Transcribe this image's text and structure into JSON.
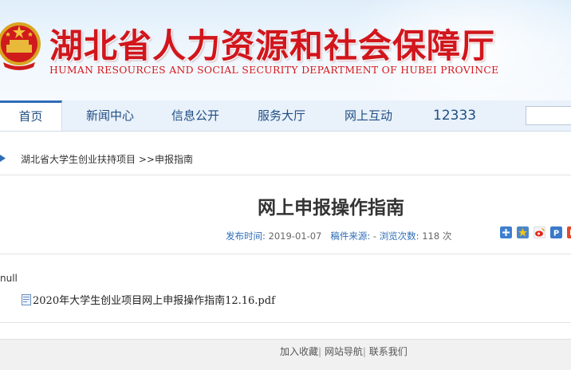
{
  "header": {
    "title": "湖北省人力资源和社会保障厅",
    "subtitle": "HUMAN RESOURCES AND SOCIAL SECURITY DEPARTMENT OF HUBEI PROVINCE",
    "brand_color": "#d1161c"
  },
  "nav": {
    "items": [
      {
        "label": "首页",
        "active": true
      },
      {
        "label": "新闻中心"
      },
      {
        "label": "信息公开"
      },
      {
        "label": "服务大厅"
      },
      {
        "label": "网上互动"
      },
      {
        "label": "12333"
      }
    ],
    "search": {
      "value": "",
      "placeholder": ""
    },
    "accent_color": "#2f6db8"
  },
  "breadcrumb": {
    "section": "湖北省大学生创业扶持项目",
    "separator": " >>",
    "current": "申报指南"
  },
  "article": {
    "title": "网上申报操作指南",
    "publish_label": "发布时间:",
    "publish_date": "2019-01-07",
    "source_label": "稿件来源:",
    "source_value": "-",
    "views_label": "浏览次数:",
    "views_count": "118",
    "views_unit": "次",
    "share_icons": [
      "add-share-icon",
      "favorite-icon",
      "weibo-icon",
      "qzone-icon",
      "print-icon"
    ],
    "body_text": "null",
    "attachment": {
      "icon": "pdf-file-icon",
      "filename": "2020年大学生创业项目网上申报操作指南12.16.pdf"
    }
  },
  "footer": {
    "links": [
      "加入收藏",
      "网站导航",
      "联系我们"
    ],
    "separator": "|"
  }
}
